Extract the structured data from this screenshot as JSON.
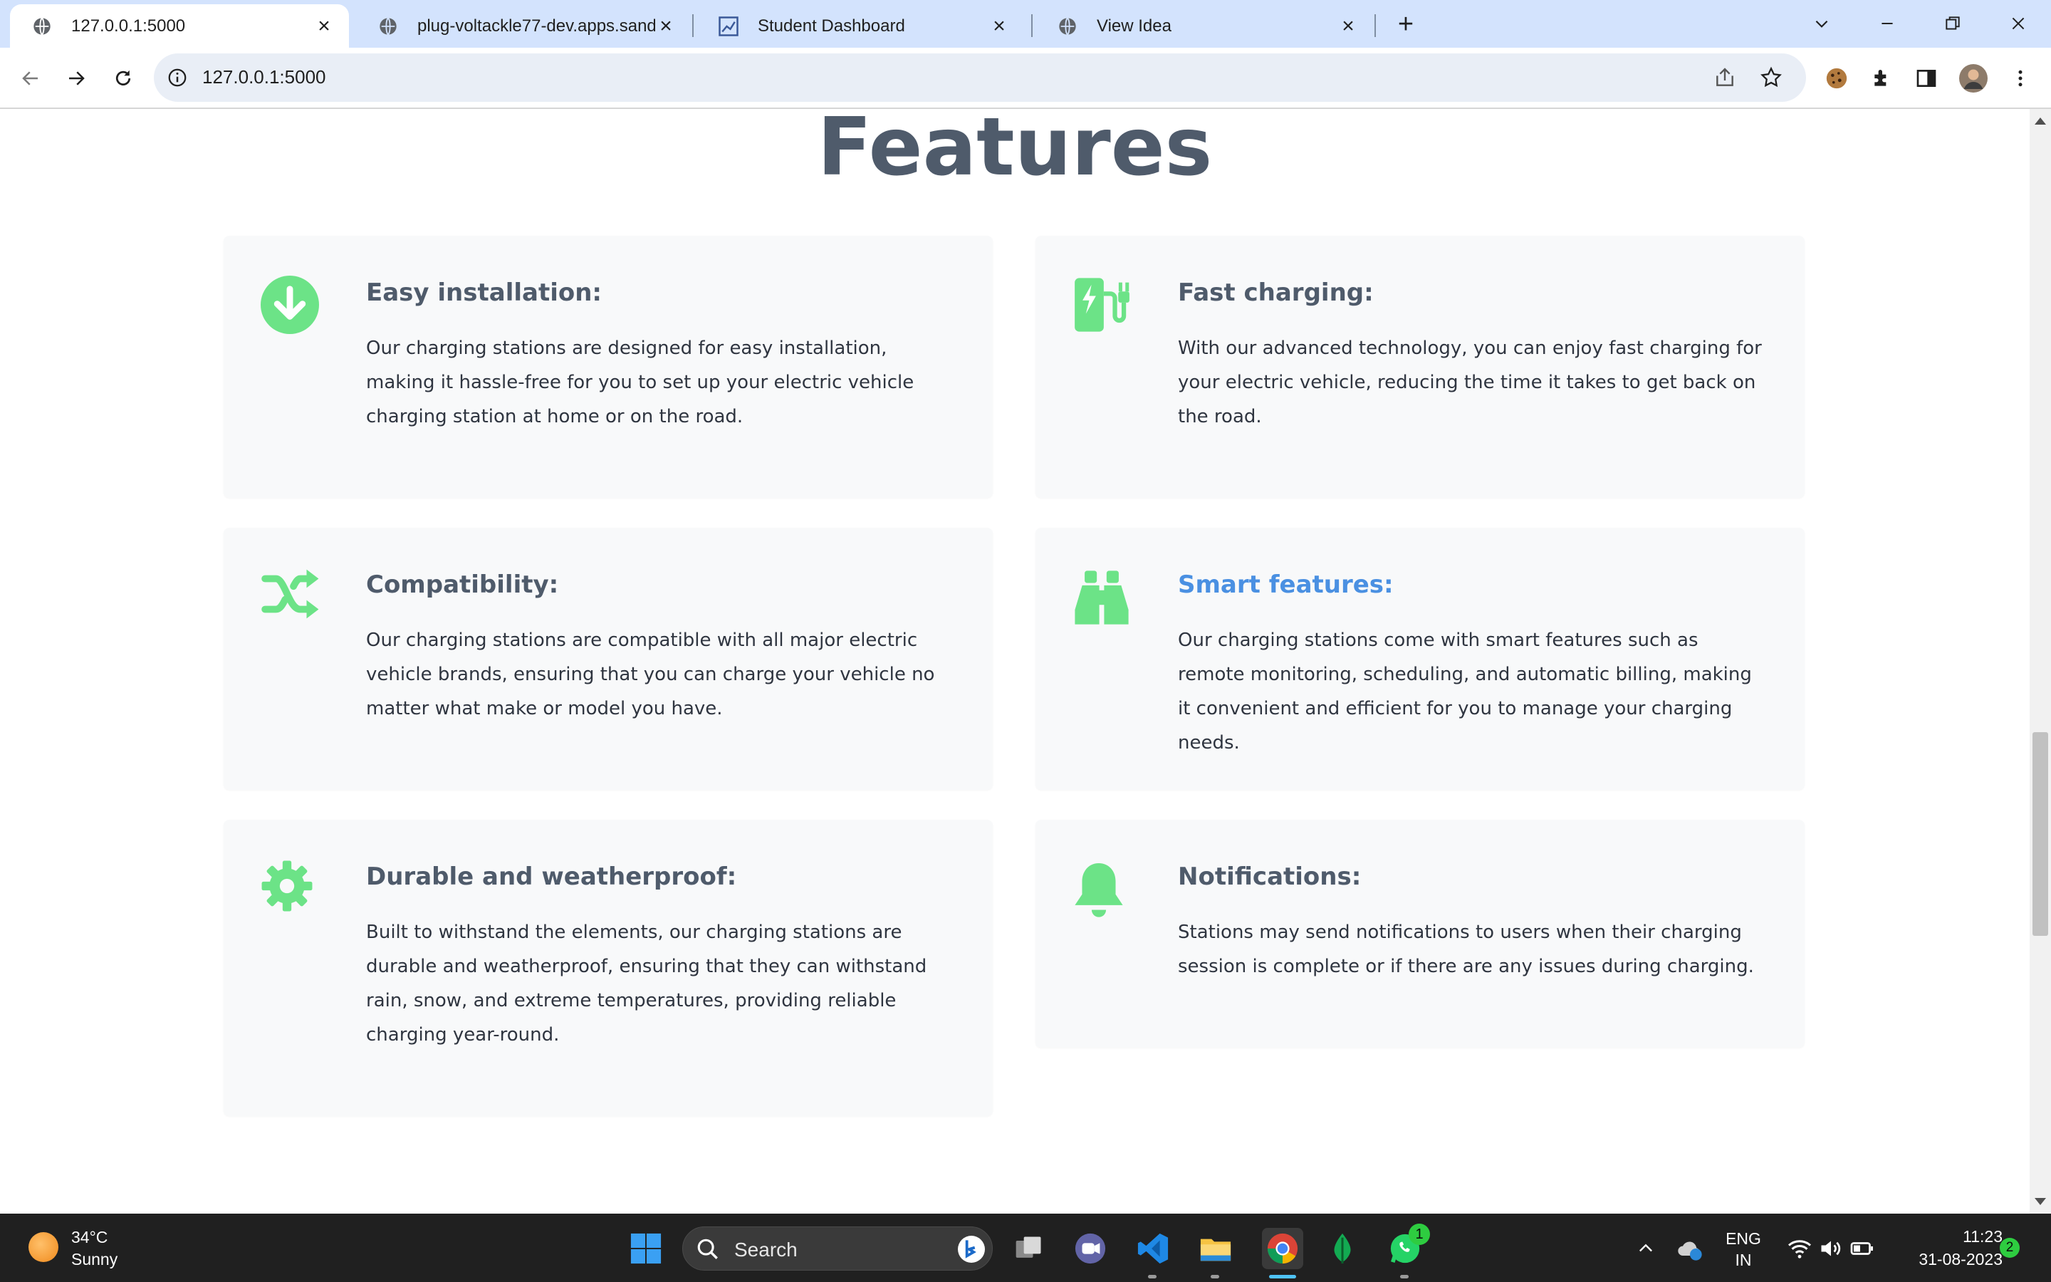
{
  "browser": {
    "tabs": [
      {
        "title": "127.0.0.1:5000",
        "active": true
      },
      {
        "title": "plug-voltackle77-dev.apps.sandb",
        "active": false
      },
      {
        "title": "Student Dashboard",
        "active": false
      },
      {
        "title": "View Idea",
        "active": false
      }
    ],
    "url": "127.0.0.1:5000"
  },
  "page": {
    "heading": "Features",
    "features": [
      {
        "icon": "arrow-circle-down-icon",
        "title": "Easy installation:",
        "description": "Our charging stations are designed for easy installation, making it hassle-free for you to set up your electric vehicle charging station at home or on the road."
      },
      {
        "icon": "charging-station-icon",
        "title": "Fast charging:",
        "description": "With our advanced technology, you can enjoy fast charging for your electric vehicle, reducing the time it takes to get back on the road."
      },
      {
        "icon": "shuffle-icon",
        "title": "Compatibility:",
        "description": "Our charging stations are compatible with all major electric vehicle brands, ensuring that you can charge your vehicle no matter what make or model you have."
      },
      {
        "icon": "binoculars-icon",
        "title": "Smart features:",
        "description": "Our charging stations come with smart features such as remote monitoring, scheduling, and automatic billing, making it convenient and efficient for you to manage your charging needs.",
        "highlighted": true
      },
      {
        "icon": "gear-icon",
        "title": "Durable and weatherproof:",
        "description": "Built to withstand the elements, our charging stations are durable and weatherproof, ensuring that they can withstand rain, snow, and extreme temperatures, providing reliable charging year-round."
      },
      {
        "icon": "bell-icon",
        "title": "Notifications:",
        "description": "Stations may send notifications to users when their charging session is complete or if there are any issues during charging."
      }
    ]
  },
  "taskbar": {
    "weather": {
      "temp": "34°C",
      "condition": "Sunny"
    },
    "search_label": "Search",
    "whatsapp_badge": "1",
    "language": {
      "line1": "ENG",
      "line2": "IN"
    },
    "time": "11:23",
    "date": "31-08-2023",
    "notification_count": "2"
  },
  "colors": {
    "accent_green": "#6ce387",
    "heading": "#4f5b6b",
    "link_blue": "#4a90e2",
    "card_bg": "#f8f9fa",
    "tabstrip_bg": "#d3e3fd"
  }
}
